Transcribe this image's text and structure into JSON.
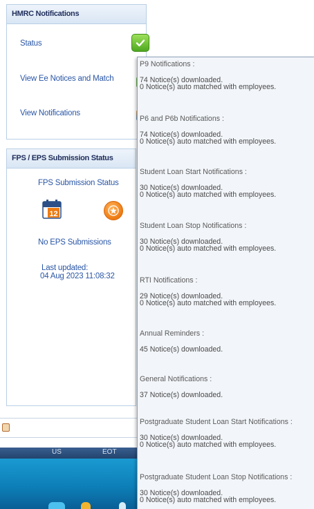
{
  "hmrc_panel": {
    "title": "HMRC Notifications",
    "status_label": "Status",
    "view_notices_label": "View Ee Notices and Match",
    "view_notifications_label": "View Notifications",
    "status_color": "#5cb82a"
  },
  "fps_panel": {
    "title": "FPS / EPS Submission Status",
    "fps_status_label": "FPS Submission Status",
    "calendar_number": "12",
    "no_eps_label": "No EPS Submissions",
    "last_updated_label": "Last updated:",
    "last_updated_value": "04 Aug 2023 11:08:32"
  },
  "status_bar": {
    "left_text": "US",
    "right_text": "EOT"
  },
  "tooltip": {
    "sections": [
      {
        "title": "P9 Notifications :",
        "lines": [
          "74 Notice(s) downloaded.",
          "0 Notice(s) auto matched with employees."
        ]
      },
      {
        "title": "P6 and P6b Notifications :",
        "lines": [
          "74 Notice(s) downloaded.",
          "0 Notice(s) auto matched with employees."
        ]
      },
      {
        "title": "Student Loan Start Notifications :",
        "lines": [
          "30 Notice(s) downloaded.",
          "0 Notice(s) auto matched with employees."
        ]
      },
      {
        "title": "Student Loan Stop Notifications :",
        "lines": [
          "30 Notice(s) downloaded.",
          "0 Notice(s) auto matched with employees."
        ]
      },
      {
        "title": "RTI Notifications :",
        "lines": [
          "29 Notice(s) downloaded.",
          "0 Notice(s) auto matched with employees."
        ]
      },
      {
        "title": "Annual Reminders :",
        "lines": [
          "45 Notice(s) downloaded."
        ]
      },
      {
        "title": "General Notifications :",
        "lines": [
          "37 Notice(s) downloaded."
        ]
      },
      {
        "title": "Postgraduate Student Loan Start Notifications :",
        "lines": [
          "30 Notice(s) downloaded.",
          "0 Notice(s) auto matched with employees."
        ]
      },
      {
        "title": "Postgraduate Student Loan Stop Notifications :",
        "lines": [
          "30 Notice(s) downloaded.",
          "0 Notice(s) auto matched with employees."
        ]
      }
    ]
  },
  "icons": {
    "status": "check-icon",
    "fps": "calendar-icon",
    "eps": "star-icon"
  }
}
